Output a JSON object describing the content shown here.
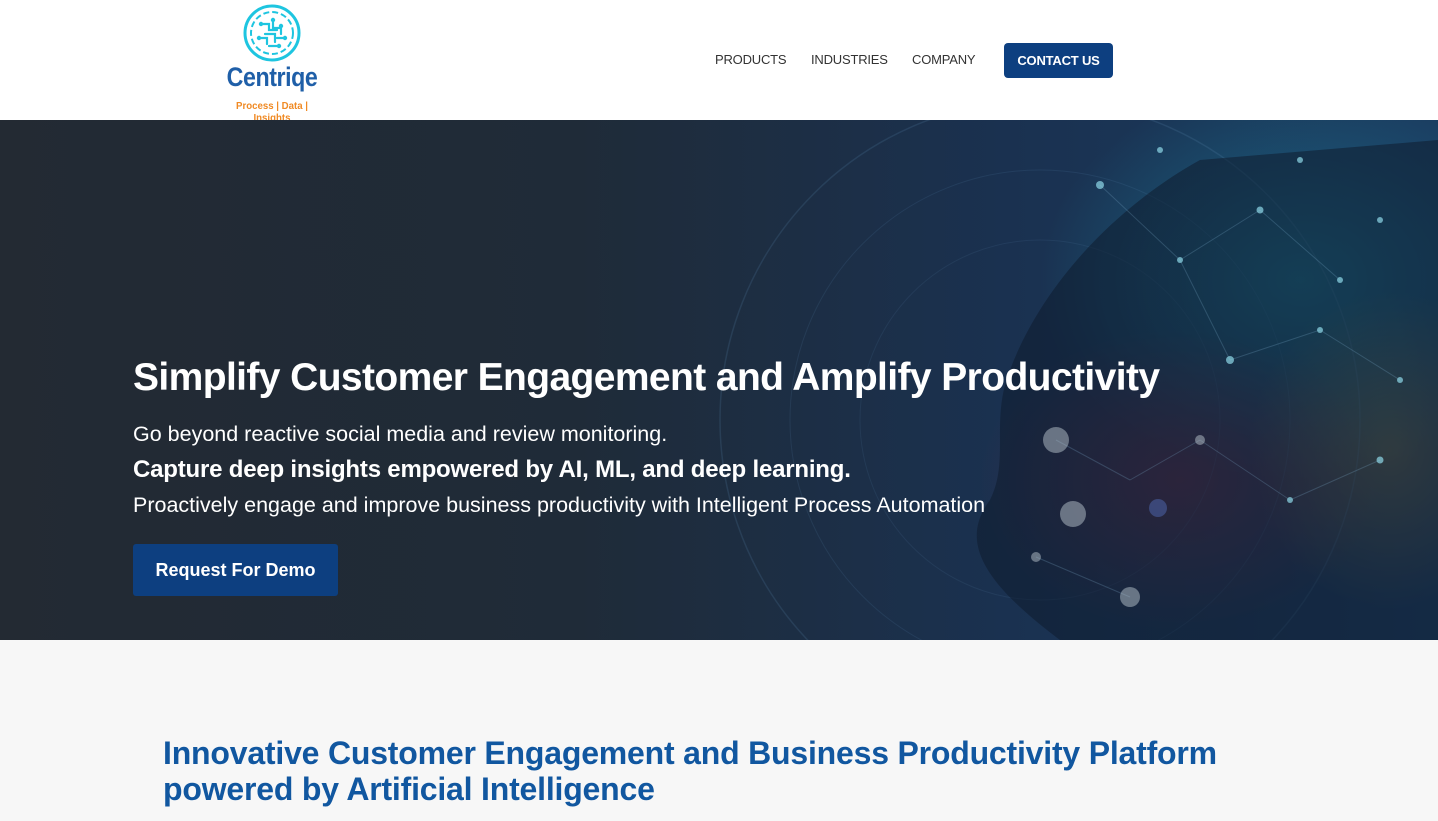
{
  "logo": {
    "wordmark": "Centriqe",
    "tagline": "Process | Data | Insights",
    "icon": "circuit-brain-icon",
    "colors": {
      "mark": "#1ec5e0",
      "word": "#1f5fa8",
      "tagline": "#f08a24"
    }
  },
  "nav": {
    "items": [
      "PRODUCTS",
      "INDUSTRIES",
      "COMPANY"
    ],
    "contact_label": "CONTACT US"
  },
  "hero": {
    "title": "Simplify Customer Engagement and Amplify Productivity",
    "line1": "Go beyond reactive social media and review monitoring.",
    "line2": "Capture deep insights empowered by AI, ML, and deep learning.",
    "line3": "Proactively engage and improve business productivity with Intelligent Process Automation",
    "cta_label": "Request For Demo"
  },
  "section": {
    "title": "Innovative Customer Engagement and Business Productivity Platform powered by Artificial Intelligence"
  },
  "colors": {
    "brand_blue": "#0d3f80",
    "heading_blue": "#1157a0",
    "accent_cyan": "#1ec5e0"
  }
}
